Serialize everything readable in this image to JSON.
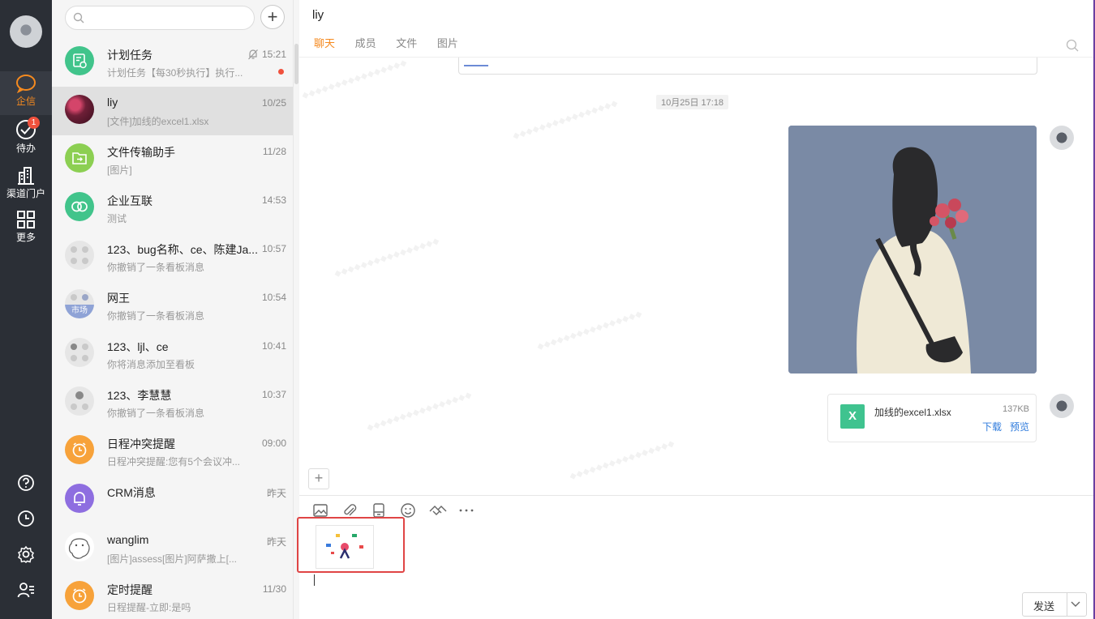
{
  "nav": {
    "items": [
      {
        "label": "企信",
        "icon": "chat-bubble-icon"
      },
      {
        "label": "待办",
        "icon": "check-circle-icon",
        "badge": "1"
      },
      {
        "label": "渠道门户",
        "icon": "buildings-icon"
      },
      {
        "label": "更多",
        "icon": "grid-icon"
      }
    ],
    "bottom_icons": [
      "help-icon",
      "clock-icon",
      "settings-icon",
      "contacts-icon"
    ]
  },
  "sessions": {
    "search_placeholder": "",
    "items": [
      {
        "name": "计划任务",
        "sub": "计划任务【每30秒执行】执行...",
        "time": "15:21",
        "muted": true,
        "unread_dot": true,
        "avatar_color": "#41c48b"
      },
      {
        "name": "liy",
        "sub": "[文件]加线的excel1.xlsx",
        "time": "10/25",
        "active": true,
        "avatar_color": "#7a2f45"
      },
      {
        "name": "文件传输助手",
        "sub": "[图片]",
        "time": "11/28",
        "avatar_color": "#8ccf52"
      },
      {
        "name": "企业互联",
        "sub": "测试",
        "time": "14:53",
        "avatar_color": "#41c48b"
      },
      {
        "name": "123、bug名称、ce、陈建Ja...",
        "sub": "你撤销了一条看板消息",
        "time": "10:57",
        "avatar_color": "#e3e3e3"
      },
      {
        "name": "网王",
        "sub": "你撤销了一条看板消息",
        "time": "10:54",
        "avatar_color": "#e3e3e3",
        "avatar_tag": "市场"
      },
      {
        "name": "123、ljl、ce",
        "sub": "你将消息添加至看板",
        "time": "10:41",
        "avatar_color": "#e3e3e3"
      },
      {
        "name": "123、李慧慧",
        "sub": "你撤销了一条看板消息",
        "time": "10:37",
        "avatar_color": "#e3e3e3"
      },
      {
        "name": "日程冲突提醒",
        "sub": "日程冲突提醒:您有5个会议冲...",
        "time": "09:00",
        "avatar_color": "#f7a23a"
      },
      {
        "name": "CRM消息",
        "sub": "",
        "time": "昨天",
        "avatar_color": "#8e6ee0"
      },
      {
        "name": "wanglim",
        "sub": "[图片]assess[图片]阿萨撒上[...",
        "time": "昨天",
        "avatar_color": "#ffffff"
      },
      {
        "name": "定时提醒",
        "sub": "日程提醒-立即:是吗",
        "time": "11/30",
        "avatar_color": "#f7a23a"
      }
    ]
  },
  "chat": {
    "title": "liy",
    "tabs": [
      "聊天",
      "成员",
      "文件",
      "图片"
    ],
    "active_tab": 0,
    "timestamp": "10月25日 17:18",
    "file": {
      "name": "加线的excel1.xlsx",
      "size": "137KB",
      "download": "下载",
      "preview": "预览",
      "icon_letter": "X"
    },
    "send_label": "发送",
    "toolbar_icons": [
      "image-icon",
      "attachment-icon",
      "card-icon",
      "emoji-icon",
      "handshake-icon",
      "more-icon"
    ]
  },
  "colors": {
    "accent": "#f58a1f",
    "nav_bg": "#2b2f36",
    "link": "#2f7bdc",
    "highlight": "#e04545"
  }
}
